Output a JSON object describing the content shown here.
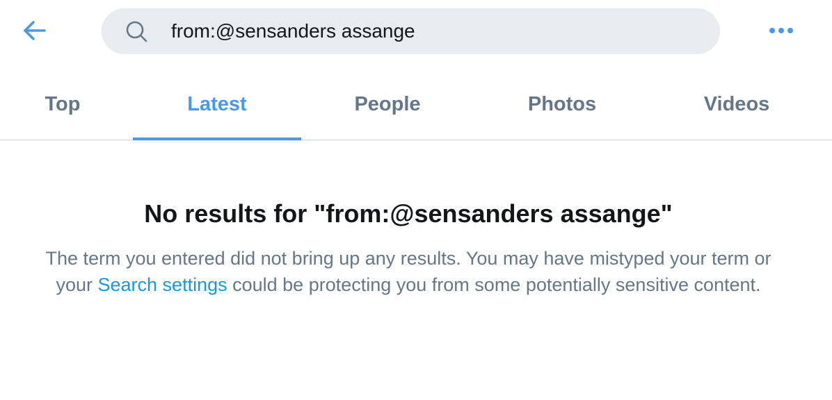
{
  "header": {
    "search": {
      "query": "from:@sensanders assange"
    }
  },
  "tabs": [
    {
      "label": "Top",
      "active": false
    },
    {
      "label": "Latest",
      "active": true
    },
    {
      "label": "People",
      "active": false
    },
    {
      "label": "Photos",
      "active": false
    },
    {
      "label": "Videos",
      "active": false
    }
  ],
  "empty_state": {
    "title": "No results for \"from:@sensanders assange\"",
    "message_before": "The term you entered did not bring up any results. You may have mistyped your term or your ",
    "link_label": "Search settings",
    "message_after": " could be protecting you from some potentially sensitive content."
  },
  "icons": {
    "back": "arrow-left-icon",
    "search": "search-icon",
    "more": "more-horizontal-icon"
  },
  "colors": {
    "accent": "#4a99e9",
    "link": "#1b95e0",
    "search_bg": "#e6ecf0",
    "muted_text": "#657786",
    "primary_text": "#14171a"
  }
}
